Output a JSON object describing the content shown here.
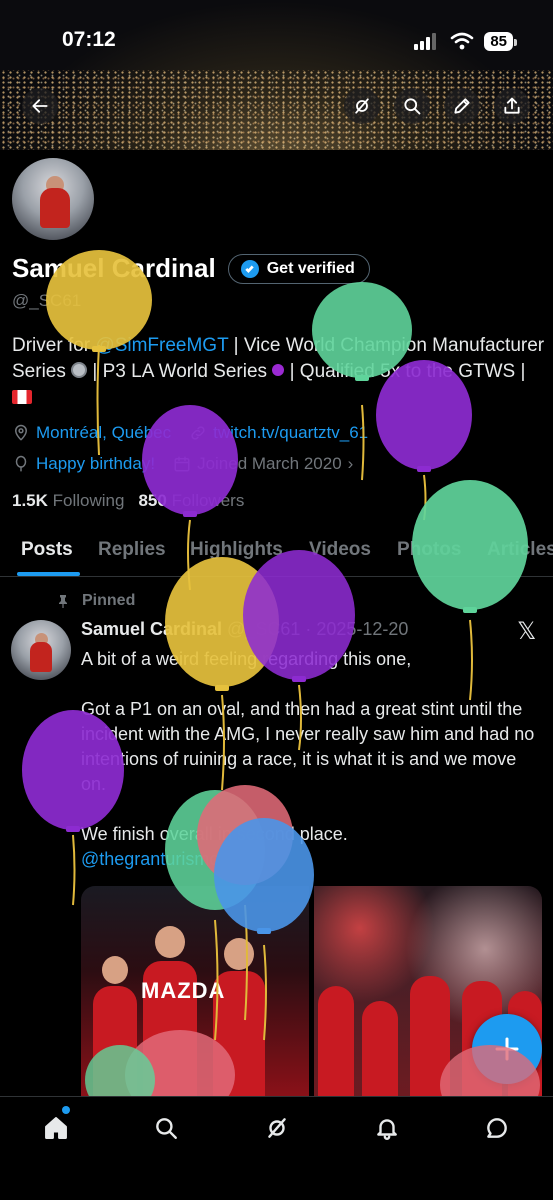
{
  "status_bar": {
    "time": "07:12",
    "battery": "85"
  },
  "profile": {
    "name": "Samuel Cardinal",
    "verify_label": "Get verified",
    "handle": "@_SC61",
    "bio": {
      "t1": "Driver for ",
      "mention1": "@SimFreeMGT",
      "t2": " | Vice World Champion Manufacturer Series ",
      "t3": " | P3 LA World Series ",
      "t4": " | Qualified 5x to the GTWS | "
    },
    "location": "Montréal, Québec",
    "website": "twitch.tv/quartztv_61",
    "birthday": "Happy birthday!",
    "joined": "Joined March 2020",
    "following_count": "1.5K",
    "following_label": "Following",
    "followers_count": "850",
    "followers_label": "Followers"
  },
  "tabs": [
    "Posts",
    "Replies",
    "Highlights",
    "Videos",
    "Photos",
    "Articles"
  ],
  "post": {
    "pinned_label": "Pinned",
    "author": "Samuel Cardinal",
    "handle": "@_SC61",
    "separator": "·",
    "date": "2025-12-20",
    "paragraphs": [
      "A bit of a weird feeling regarding this one,",
      "Got a P1 on an oval, and then had a great stint until the incident with the AMG, I never really saw him and had no intentions of ruining a race, it is what it is and we move on.",
      "We finish overall in second place."
    ],
    "mention": "@thegranturismo",
    "media_left_caption": "MAZDA"
  },
  "icons": {
    "back": "arrow-left-icon",
    "grok": "grok-icon",
    "search": "search-icon",
    "edit": "pencil-icon",
    "share": "share-icon",
    "x_logo": "𝕏"
  },
  "colors": {
    "accent": "#1d9bf0",
    "background": "#000000",
    "muted": "#71767b"
  }
}
